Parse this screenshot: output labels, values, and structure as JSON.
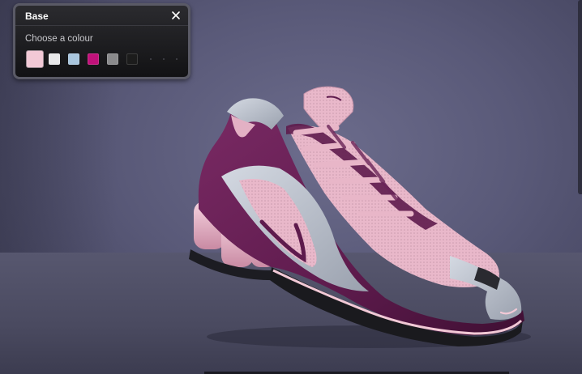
{
  "panel": {
    "title": "Base",
    "label": "Choose a colour",
    "swatches": [
      {
        "name": "light-pink",
        "color": "#f2c9d6",
        "selected": true
      },
      {
        "name": "white",
        "color": "#e8e8ea",
        "selected": false
      },
      {
        "name": "light-blue",
        "color": "#a9c6de",
        "selected": false
      },
      {
        "name": "magenta",
        "color": "#c1117a",
        "selected": false
      },
      {
        "name": "grey",
        "color": "#8a8a8c",
        "selected": false
      },
      {
        "name": "black",
        "color": "#1c1c1c",
        "selected": false
      }
    ]
  },
  "shoe": {
    "primary": "#5e1b4d",
    "mesh": "#e7b7c8",
    "overlay": "#b9c0cc",
    "sole": "#1a1a1e",
    "icons": [
      "swoosh-icon"
    ]
  },
  "colors": {
    "background": "#595978",
    "panel_bg": "#1b1b1e"
  }
}
